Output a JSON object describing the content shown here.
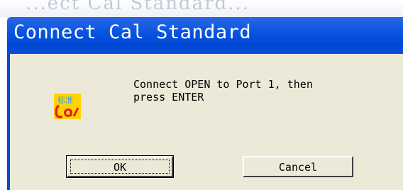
{
  "background_window": {
    "partial_title": "...ect Cal Standard..."
  },
  "dialog": {
    "title": "Connect Cal Standard",
    "icon": "cal-standard-icon",
    "message_line1": "Connect OPEN to Port 1, then",
    "message_line2": "press ENTER",
    "ok_label": "OK",
    "cancel_label": "Cancel"
  },
  "colors": {
    "titlebar": "#0a56e0",
    "dialog_bg": "#ece9d8",
    "icon_bg": "#ffd400",
    "icon_red": "#e2211c"
  }
}
